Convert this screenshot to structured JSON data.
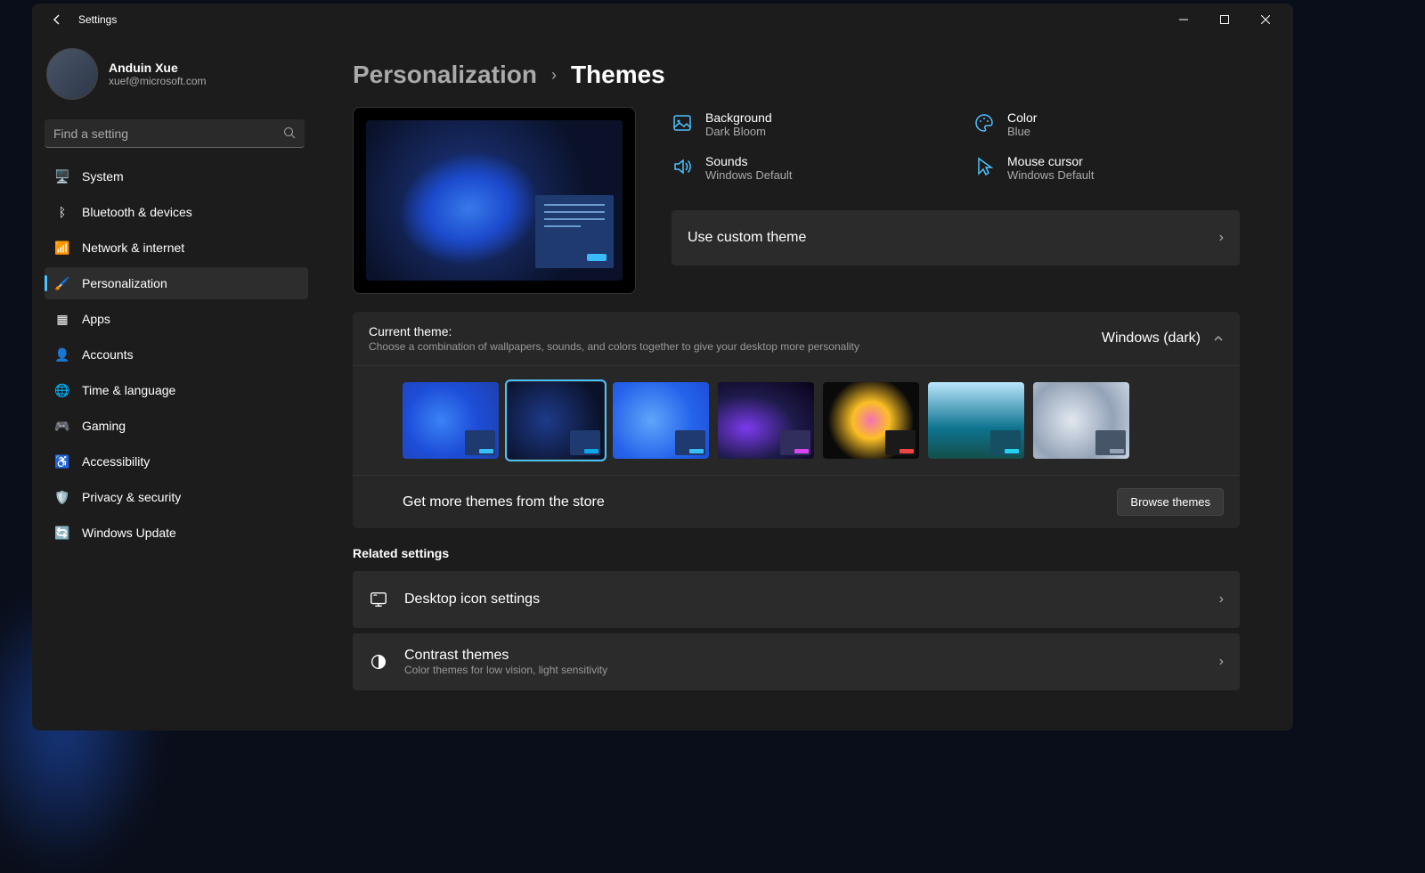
{
  "titlebar": {
    "title": "Settings"
  },
  "profile": {
    "name": "Anduin Xue",
    "email": "xuef@microsoft.com"
  },
  "search": {
    "placeholder": "Find a setting"
  },
  "nav": [
    {
      "label": "System",
      "icon": "🖥️",
      "selected": false
    },
    {
      "label": "Bluetooth & devices",
      "icon": "ᛒ",
      "selected": false
    },
    {
      "label": "Network & internet",
      "icon": "📶",
      "selected": false
    },
    {
      "label": "Personalization",
      "icon": "🖌️",
      "selected": true
    },
    {
      "label": "Apps",
      "icon": "▦",
      "selected": false
    },
    {
      "label": "Accounts",
      "icon": "👤",
      "selected": false
    },
    {
      "label": "Time & language",
      "icon": "🌐",
      "selected": false
    },
    {
      "label": "Gaming",
      "icon": "🎮",
      "selected": false
    },
    {
      "label": "Accessibility",
      "icon": "♿",
      "selected": false
    },
    {
      "label": "Privacy & security",
      "icon": "🛡️",
      "selected": false
    },
    {
      "label": "Windows Update",
      "icon": "🔄",
      "selected": false
    }
  ],
  "breadcrumb": {
    "parent": "Personalization",
    "current": "Themes"
  },
  "meta": {
    "background": {
      "label": "Background",
      "value": "Dark Bloom"
    },
    "color": {
      "label": "Color",
      "value": "Blue"
    },
    "sounds": {
      "label": "Sounds",
      "value": "Windows Default"
    },
    "cursor": {
      "label": "Mouse cursor",
      "value": "Windows Default"
    }
  },
  "custom_theme": {
    "label": "Use custom theme"
  },
  "current_theme": {
    "title": "Current theme:",
    "subtitle": "Choose a combination of wallpapers, sounds, and colors together to give your desktop more personality",
    "value": "Windows (dark)"
  },
  "themes": [
    {
      "bg": "radial-gradient(circle at 40% 50%, #3b82f6 0%, #1d4ed8 50%, #1e40af 100%)",
      "card": "#1e3a6e",
      "btn": "#38bdf8",
      "selected": false
    },
    {
      "bg": "radial-gradient(circle at 40% 50%, #1e3a8a 0%, #0a1128 80%)",
      "card": "#1e3a6e",
      "btn": "#0ea5e9",
      "selected": true
    },
    {
      "bg": "radial-gradient(circle at 40% 50%, #60a5fa 0%, #2563eb 60%, #1d4ed8 100%)",
      "card": "#1e3a6e",
      "btn": "#38bdf8",
      "selected": false
    },
    {
      "bg": "radial-gradient(ellipse at 30% 60%, #7c3aed 0%, #1e1b4b 50%, #0a0118 100%)",
      "card": "#312e5e",
      "btn": "#d946ef",
      "selected": false
    },
    {
      "bg": "radial-gradient(circle at 50% 50%, #f472b6 0%, #fbbf24 30%, #0a0a0a 70%)",
      "card": "#1a1a1a",
      "btn": "#ef4444",
      "selected": false
    },
    {
      "bg": "linear-gradient(180deg, #bae6fd 0%, #0e7490 60%, #134e4a 100%)",
      "card": "#164e63",
      "btn": "#22d3ee",
      "selected": false
    },
    {
      "bg": "radial-gradient(circle at 40% 50%, #e2e8f0 0%, #94a3b8 60%, #cbd5e1 100%)",
      "card": "#475569",
      "btn": "#94a3b8",
      "selected": false
    }
  ],
  "store": {
    "text": "Get more themes from the store",
    "button": "Browse themes"
  },
  "related": {
    "heading": "Related settings",
    "desktop_icons": {
      "label": "Desktop icon settings"
    },
    "contrast": {
      "label": "Contrast themes",
      "sub": "Color themes for low vision, light sensitivity"
    }
  }
}
